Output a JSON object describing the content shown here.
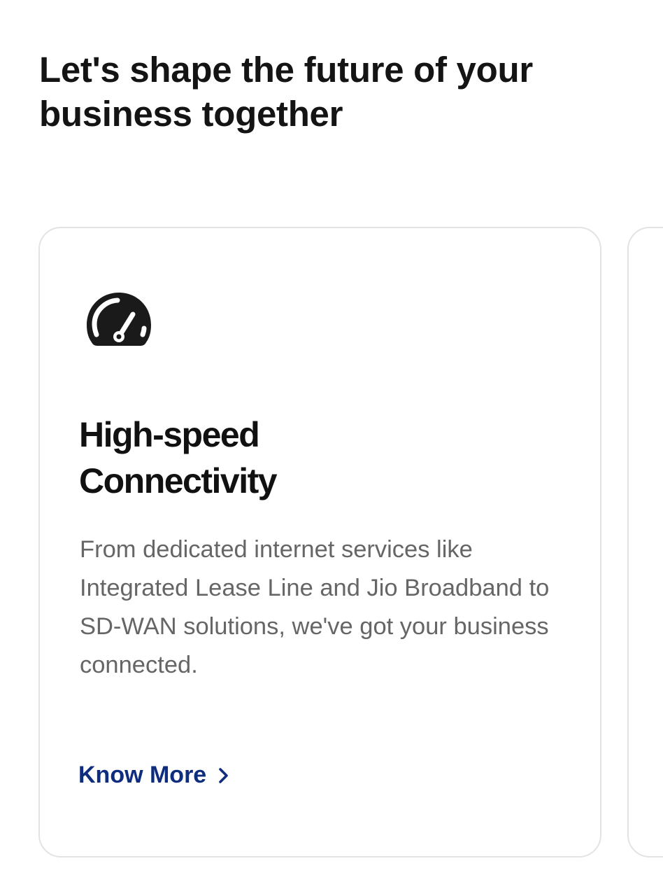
{
  "section": {
    "title": "Let's shape the future of your business together"
  },
  "cards": [
    {
      "icon": "speedometer-icon",
      "title_line1": "High-speed",
      "title_line2": "Connectivity",
      "description": "From dedicated internet services like Integrated Lease Line and Jio Broadband to SD-WAN solutions, we've got your business connected.",
      "link_label": "Know More",
      "link_icon": "chevron-right-icon"
    }
  ],
  "colors": {
    "heading": "#141414",
    "body_text": "#666666",
    "link": "#0f2d7d",
    "card_border": "#e3e3e3",
    "icon": "#1a1a1a"
  }
}
